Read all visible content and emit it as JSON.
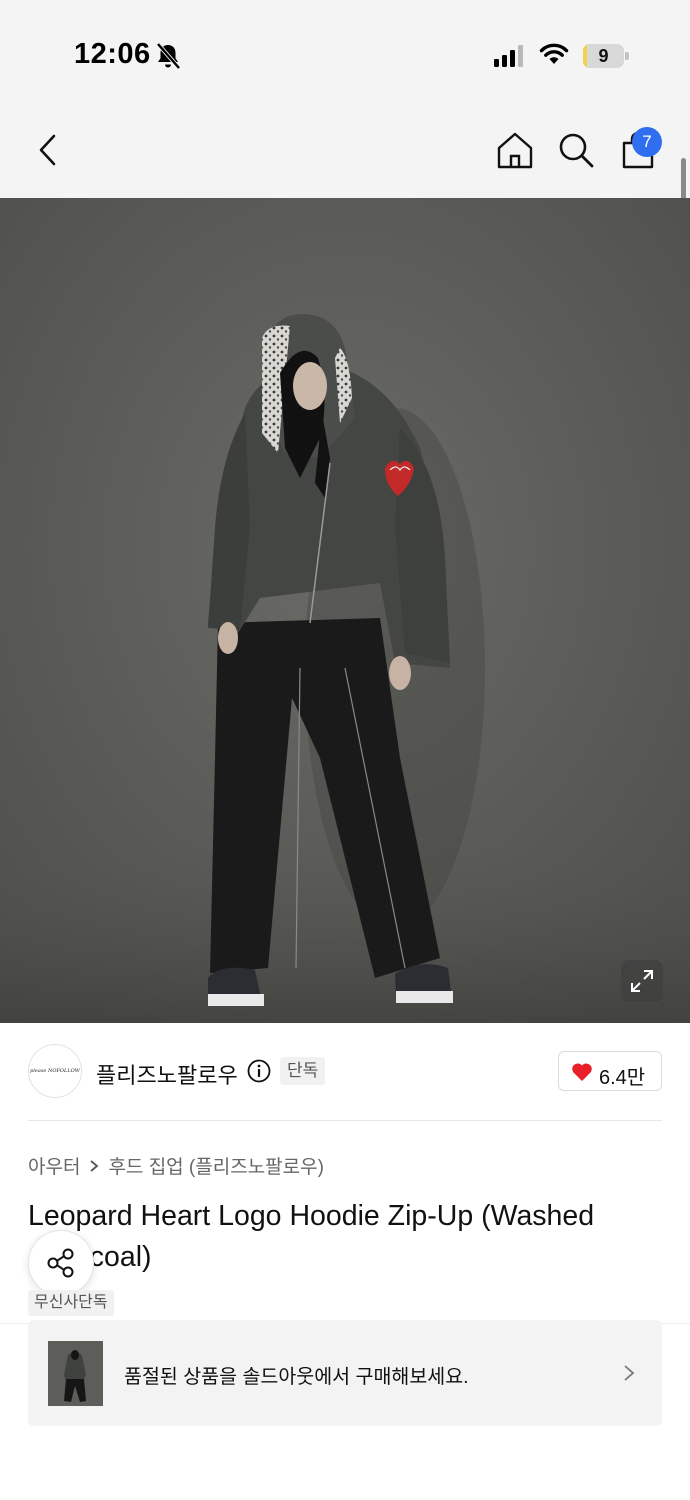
{
  "status_bar": {
    "time": "12:06",
    "battery": "9",
    "battery_level": 0.09
  },
  "nav": {
    "cart_count": "7"
  },
  "brand": {
    "name": "플리즈노팔로우",
    "logo_text": "please NOFOLLOW",
    "exclusive_tag": "단독",
    "likes": "6.4만"
  },
  "breadcrumb": {
    "category": "아우터",
    "subcategory": "후드 집업 (플리즈노팔로우)"
  },
  "product": {
    "title": "Leopard Heart Logo Hoodie Zip-Up (Washed Charcoal)",
    "musinsa_tag": "무신사단독"
  },
  "soldout_banner": {
    "text": "품절된 상품을 솔드아웃에서 구매해보세요."
  },
  "colors": {
    "accent_blue": "#2f6fef",
    "heart_red": "#e8202a",
    "nav_background": "#f4f4f4"
  }
}
